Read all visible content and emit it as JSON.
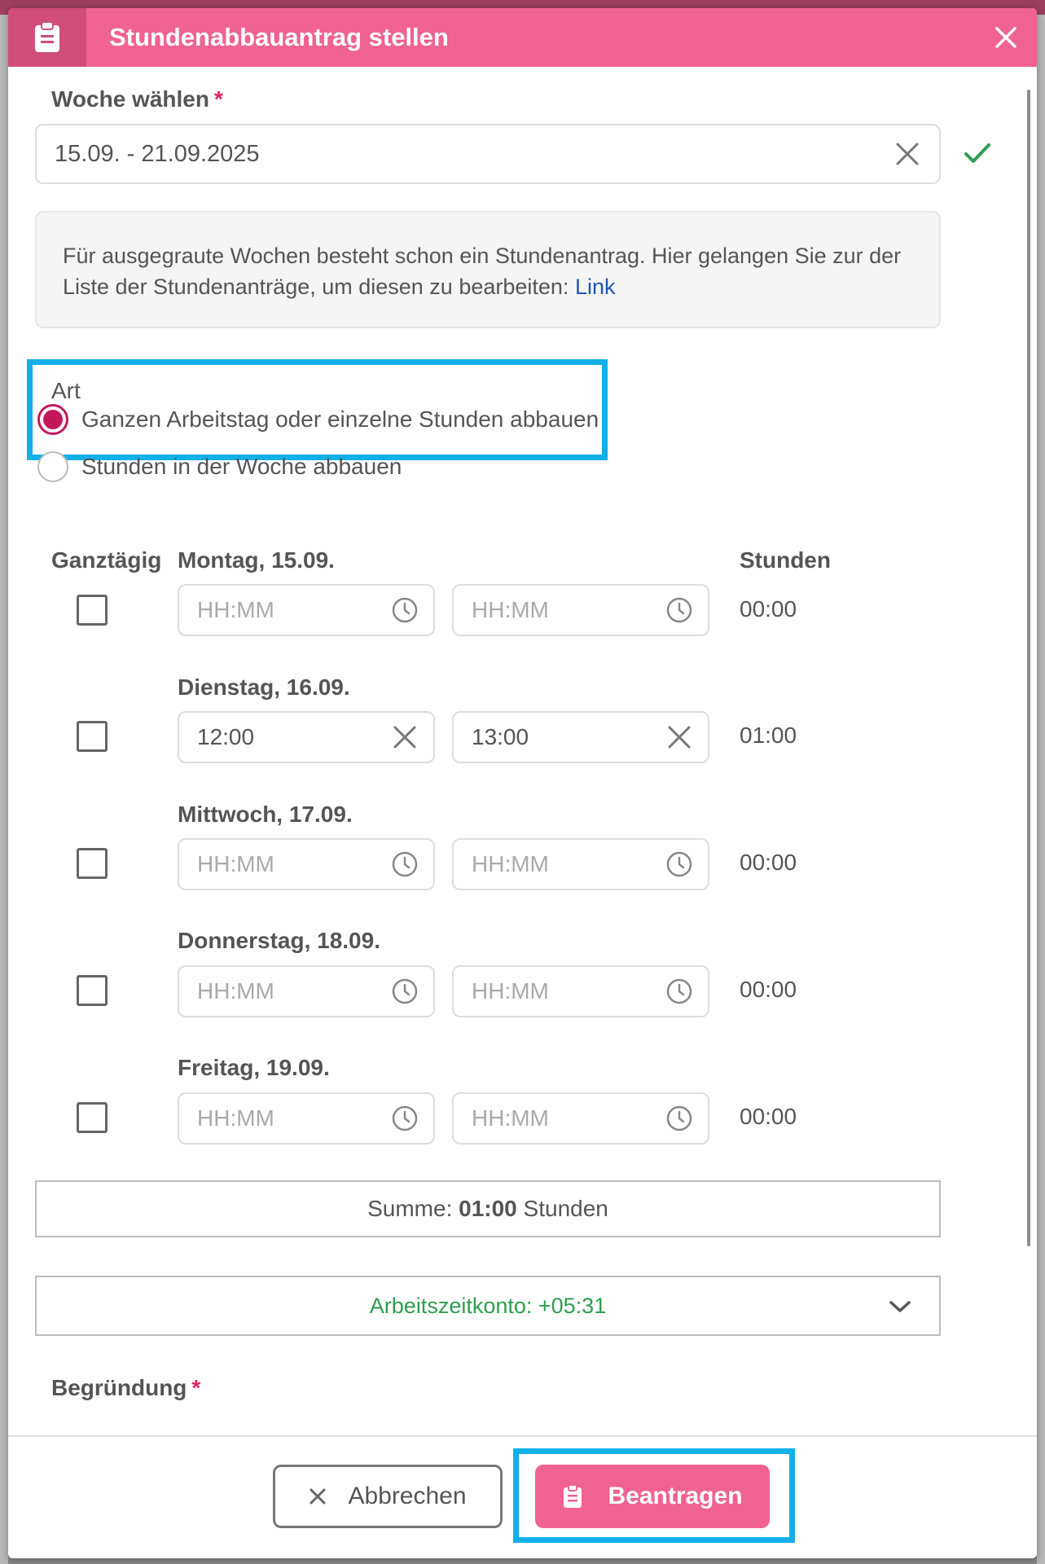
{
  "dialog": {
    "title": "Stundenabbauantrag stellen",
    "title_icon": "clipboard-icon",
    "close_icon": "close-icon"
  },
  "week": {
    "label": "Woche wählen",
    "required_marker": "*",
    "value": "15.09. - 21.09.2025",
    "clear_icon": "close-icon",
    "valid_icon": "check-icon"
  },
  "info": {
    "text": "Für ausgegraute Wochen besteht schon ein Stundenantrag. Hier gelangen Sie zur der Liste der Stundenanträge, um diesen zu bearbeiten: ",
    "link_label": "Link"
  },
  "art": {
    "label": "Art",
    "options": [
      {
        "label": "Ganzen Arbeitstag oder einzelne Stunden abbauen",
        "checked": true
      },
      {
        "label": "Stunden in der Woche abbauen",
        "checked": false
      }
    ]
  },
  "table": {
    "col_fullday": "Ganztägig",
    "col_hours": "Stunden",
    "placeholder": "HH:MM",
    "days": [
      {
        "label": "Montag, 15.09.",
        "from": "",
        "to": "",
        "hours": "00:00",
        "fullday": false
      },
      {
        "label": "Dienstag, 16.09.",
        "from": "12:00",
        "to": "13:00",
        "hours": "01:00",
        "fullday": false
      },
      {
        "label": "Mittwoch, 17.09.",
        "from": "",
        "to": "",
        "hours": "00:00",
        "fullday": false
      },
      {
        "label": "Donnerstag, 18.09.",
        "from": "",
        "to": "",
        "hours": "00:00",
        "fullday": false
      },
      {
        "label": "Freitag, 19.09.",
        "from": "",
        "to": "",
        "hours": "00:00",
        "fullday": false
      }
    ]
  },
  "summary": {
    "prefix": "Summe: ",
    "value": "01:00",
    "suffix": " Stunden"
  },
  "account": {
    "label": "Arbeitszeitkonto: +05:31",
    "color": "#2e9e4f",
    "expand_icon": "chevron-down-icon"
  },
  "reason": {
    "label": "Begründung",
    "required_marker": "*"
  },
  "footer": {
    "cancel_label": "Abbrechen",
    "submit_label": "Beantragen"
  },
  "colors": {
    "primary": "#f06292",
    "primary_dark": "#d04e79",
    "radio": "#c2185b",
    "highlight": "#12b0e8",
    "link": "#1e56b8"
  }
}
